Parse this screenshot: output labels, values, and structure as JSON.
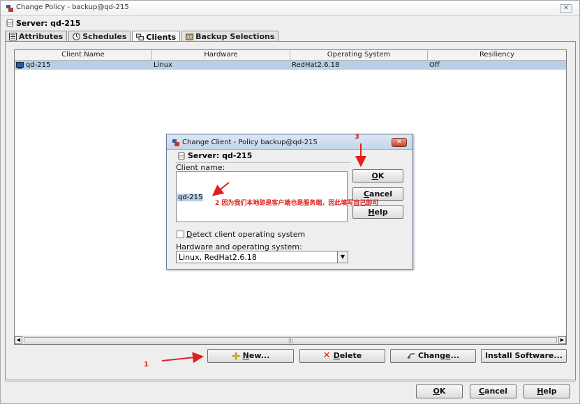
{
  "window": {
    "title": "Change Policy - backup@qd-215",
    "server_label": "Server: qd-215"
  },
  "tabs": [
    {
      "label": "Attributes",
      "icon": "attributes-icon",
      "active": false
    },
    {
      "label": "Schedules",
      "icon": "schedules-icon",
      "active": false
    },
    {
      "label": "Clients",
      "icon": "clients-icon",
      "active": true
    },
    {
      "label": "Backup Selections",
      "icon": "backup-selections-icon",
      "active": false
    }
  ],
  "table": {
    "columns": [
      "Client Name",
      "Hardware",
      "Operating System",
      "Resiliency"
    ],
    "rows": [
      {
        "client_name": "qd-215",
        "hardware": "Linux",
        "os": "RedHat2.6.18",
        "resiliency": "Off"
      }
    ]
  },
  "panel_buttons": {
    "new": {
      "pre": "",
      "key": "N",
      "post": "ew..."
    },
    "delete": {
      "pre": "",
      "key": "D",
      "post": "elete"
    },
    "change": {
      "pre": "Chang",
      "key": "e",
      "post": "..."
    },
    "install": {
      "label": "Install Software..."
    }
  },
  "footer_buttons": {
    "ok": {
      "key": "O",
      "post": "K"
    },
    "cancel": {
      "key": "C",
      "post": "ancel"
    },
    "help": {
      "key": "H",
      "post": "elp"
    }
  },
  "dialog": {
    "title": "Change Client - Policy backup@qd-215",
    "server_label": "Server: qd-215",
    "client_name_label": "Client name:",
    "client_name_value": "qd-215",
    "detect_checkbox": {
      "key": "D",
      "post": "etect client operating system",
      "checked": false
    },
    "hw_os_label": "Hardware and operating system:",
    "hw_os_value": "Linux, RedHat2.6.18",
    "buttons": {
      "ok": {
        "key": "O",
        "post": "K"
      },
      "cancel": {
        "key": "C",
        "post": "ancel"
      },
      "help": {
        "key": "H",
        "post": "elp"
      }
    }
  },
  "annotations": {
    "marker_1": "1",
    "marker_2_text": "2 因为我们本地即是客户端也是服务端，因此填写自己即可",
    "marker_3": "3",
    "color": "#e0201c"
  }
}
